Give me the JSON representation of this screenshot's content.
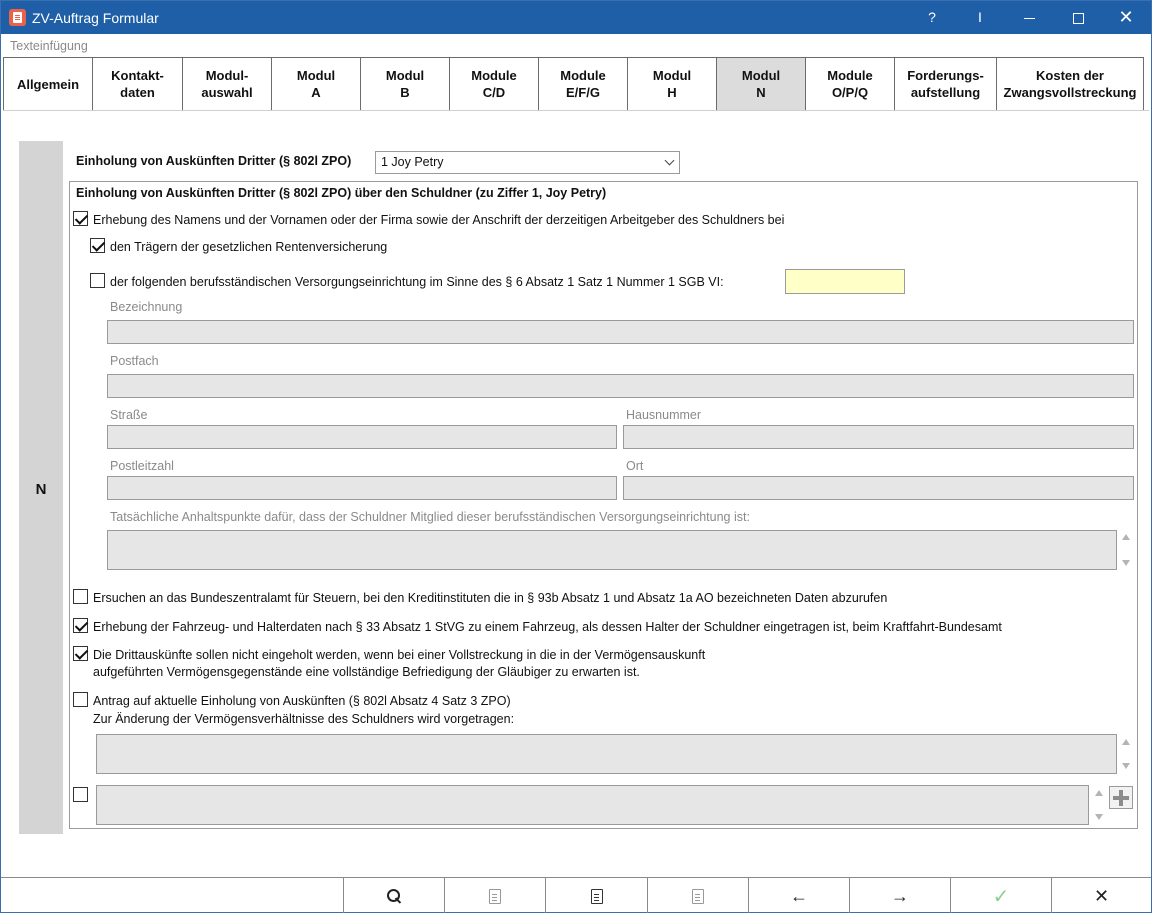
{
  "window": {
    "title": "ZV-Auftrag Formular"
  },
  "titlebar": {
    "help": "?",
    "cursor": "I",
    "close": "✕"
  },
  "menu": {
    "label": "Texteinfügung"
  },
  "tabs": [
    {
      "label": "Allgemein"
    },
    {
      "label": "Kontakt-\ndaten"
    },
    {
      "label": "Modul-\nauswahl"
    },
    {
      "label": "Modul\nA"
    },
    {
      "label": "Modul\nB"
    },
    {
      "label": "Module\nC/D"
    },
    {
      "label": "Module\nE/F/G"
    },
    {
      "label": "Modul\nH"
    },
    {
      "label": "Modul\nN",
      "active": true
    },
    {
      "label": "Module\nO/P/Q"
    },
    {
      "label": "Forderungs-\naufstellung"
    },
    {
      "label": "Kosten der\nZwangsvollstreckung"
    }
  ],
  "section": {
    "letter": "N"
  },
  "einholung": {
    "label": "Einholung von Auskünften Dritter (§ 802l ZPO)",
    "selected": "1 Joy Petry"
  },
  "group": {
    "title": "Einholung von Auskünften Dritter (§ 802l ZPO) über den Schuldner  (zu Ziffer 1,  Joy Petry)",
    "erhebung_label": "Erhebung des Namens und der Vornamen oder der Firma sowie der Anschrift der derzeitigen Arbeitgeber des Schuldners bei",
    "erhebung_checked": true,
    "renten_label": "den Trägern der gesetzlichen Rentenversicherung",
    "renten_checked": true,
    "versorgung_label": "der folgenden berufsständischen Versorgungseinrichtung im Sinne des § 6 Absatz 1 Satz 1 Nummer 1 SGB VI:",
    "versorgung_checked": false,
    "bezeichnung_label": "Bezeichnung",
    "postfach_label": "Postfach",
    "strasse_label": "Straße",
    "hausnummer_label": "Hausnummer",
    "plz_label": "Postleitzahl",
    "ort_label": "Ort",
    "anhalt_label": "Tatsächliche Anhaltspunkte dafür, dass der Schuldner Mitglied dieser berufsständischen Versorgungseinrichtung ist:",
    "bzst_label": "Ersuchen an das Bundeszentralamt für Steuern, bei den Kreditinstituten die in § 93b Absatz 1 und Absatz 1a AO bezeichneten Daten abzurufen",
    "bzst_checked": false,
    "kba_label": "Erhebung der Fahrzeug- und Halterdaten nach § 33 Absatz 1 StVG zu einem Fahrzeug, als dessen Halter der Schuldner eingetragen ist, beim Kraftfahrt-Bundesamt",
    "kba_checked": true,
    "dritt_line1": "Die Drittauskünfte sollen nicht eingeholt werden, wenn bei einer Vollstreckung in die in der Vermögensauskunft",
    "dritt_line2": "aufgeführten Vermögensgegenstände eine vollständige Befriedigung der Gläubiger zu erwarten ist.",
    "dritt_checked": true,
    "antrag_label": "Antrag auf aktuelle Einholung von Auskünften (§ 802l Absatz 4 Satz 3 ZPO)",
    "antrag_checked": false,
    "aenderung_label": "Zur Änderung der Vermögensverhältnisse des Schuldners wird vorgetragen:",
    "extra_checked": false
  },
  "toolbar": {
    "back": "←",
    "forward": "→",
    "ok": "✓",
    "cancel": "✕"
  },
  "icons": {
    "search": "search-icon",
    "paste": "clipboard-icon",
    "paste_doc": "clipboard-doc-icon",
    "export": "export-icon"
  }
}
